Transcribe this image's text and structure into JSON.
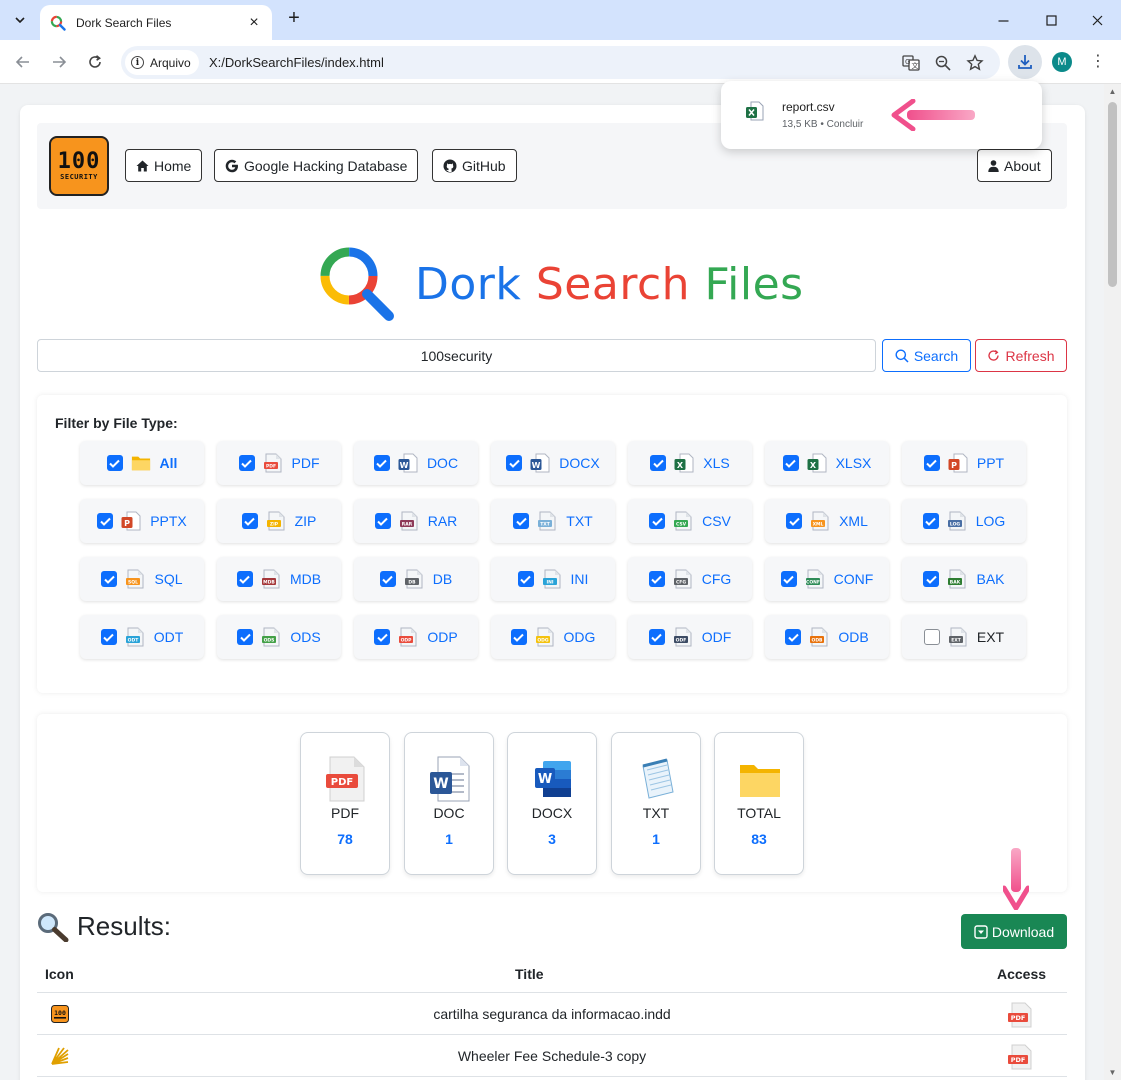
{
  "browser": {
    "tab_title": "Dork Search Files",
    "chip_label": "Arquivo",
    "url": "X:/DorkSearchFiles/index.html",
    "avatar_letter": "M",
    "download": {
      "filename": "report.csv",
      "status": "13,5 KB • Concluir"
    }
  },
  "nav": {
    "logo_big": "100",
    "logo_small": "SECURITY",
    "home": "Home",
    "ghdb": "Google Hacking Database",
    "github": "GitHub",
    "about": "About"
  },
  "brand": {
    "part1": "Dork",
    "part2": "Search",
    "part3": "Files"
  },
  "search": {
    "value": "100security",
    "search_label": "Search",
    "refresh_label": "Refresh"
  },
  "filter": {
    "title": "Filter by File Type:",
    "types": [
      {
        "label": "All",
        "checked": true,
        "icon": "folder-icon",
        "color": "#f4b400"
      },
      {
        "label": "PDF",
        "checked": true,
        "icon": "pdf-icon",
        "color": "#e94b3c"
      },
      {
        "label": "DOC",
        "checked": true,
        "icon": "doc-icon",
        "color": "#2b5797"
      },
      {
        "label": "DOCX",
        "checked": true,
        "icon": "docx-icon",
        "color": "#2b5797"
      },
      {
        "label": "XLS",
        "checked": true,
        "icon": "xls-icon",
        "color": "#1e7145"
      },
      {
        "label": "XLSX",
        "checked": true,
        "icon": "xlsx-icon",
        "color": "#1e7145"
      },
      {
        "label": "PPT",
        "checked": true,
        "icon": "ppt-icon",
        "color": "#d24726"
      },
      {
        "label": "PPTX",
        "checked": true,
        "icon": "pptx-icon",
        "color": "#d24726"
      },
      {
        "label": "ZIP",
        "checked": true,
        "icon": "zip-icon",
        "color": "#f4b400"
      },
      {
        "label": "RAR",
        "checked": true,
        "icon": "rar-icon",
        "color": "#8e3a59"
      },
      {
        "label": "TXT",
        "checked": true,
        "icon": "txt-icon",
        "color": "#7ab0d8"
      },
      {
        "label": "CSV",
        "checked": true,
        "icon": "csv-icon",
        "color": "#34a853"
      },
      {
        "label": "XML",
        "checked": true,
        "icon": "xml-icon",
        "color": "#f7941d"
      },
      {
        "label": "LOG",
        "checked": true,
        "icon": "log-icon",
        "color": "#4a6fa5"
      },
      {
        "label": "SQL",
        "checked": true,
        "icon": "sql-icon",
        "color": "#f7941d"
      },
      {
        "label": "MDB",
        "checked": true,
        "icon": "mdb-icon",
        "color": "#a4373a"
      },
      {
        "label": "DB",
        "checked": true,
        "icon": "db-icon",
        "color": "#5f6368"
      },
      {
        "label": "INI",
        "checked": true,
        "icon": "ini-icon",
        "color": "#29a3d8"
      },
      {
        "label": "CFG",
        "checked": true,
        "icon": "cfg-icon",
        "color": "#5f6368"
      },
      {
        "label": "CONF",
        "checked": true,
        "icon": "conf-icon",
        "color": "#2e8b57"
      },
      {
        "label": "BAK",
        "checked": true,
        "icon": "bak-icon",
        "color": "#2e7d32"
      },
      {
        "label": "ODT",
        "checked": true,
        "icon": "odt-icon",
        "color": "#29a3d8"
      },
      {
        "label": "ODS",
        "checked": true,
        "icon": "ods-icon",
        "color": "#43a047"
      },
      {
        "label": "ODP",
        "checked": true,
        "icon": "odp-icon",
        "color": "#e94b3c"
      },
      {
        "label": "ODG",
        "checked": true,
        "icon": "odg-icon",
        "color": "#f4c20d"
      },
      {
        "label": "ODF",
        "checked": true,
        "icon": "odf-icon",
        "color": "#3c4b64"
      },
      {
        "label": "ODB",
        "checked": true,
        "icon": "odb-icon",
        "color": "#e8710a"
      },
      {
        "label": "EXT",
        "checked": false,
        "icon": "ext-icon",
        "color": "#5f6368"
      }
    ]
  },
  "stats": [
    {
      "label": "PDF",
      "value": "78",
      "icon": "pdf-icon"
    },
    {
      "label": "DOC",
      "value": "1",
      "icon": "doc-icon"
    },
    {
      "label": "DOCX",
      "value": "3",
      "icon": "docx-icon"
    },
    {
      "label": "TXT",
      "value": "1",
      "icon": "txt-icon"
    },
    {
      "label": "TOTAL",
      "value": "83",
      "icon": "folder-icon"
    }
  ],
  "results": {
    "title": "Results:",
    "download_label": "Download",
    "headers": {
      "icon": "Icon",
      "title": "Title",
      "access": "Access"
    },
    "rows": [
      {
        "title": "cartilha seguranca da informacao.indd",
        "icon": "100security-logo-icon"
      },
      {
        "title": "Wheeler Fee Schedule-3 copy",
        "icon": "sunburst-logo-icon"
      }
    ]
  },
  "colors": {
    "primary": "#0d6efd",
    "danger": "#dc3545",
    "success": "#198754",
    "arrow": "#f0508c"
  }
}
